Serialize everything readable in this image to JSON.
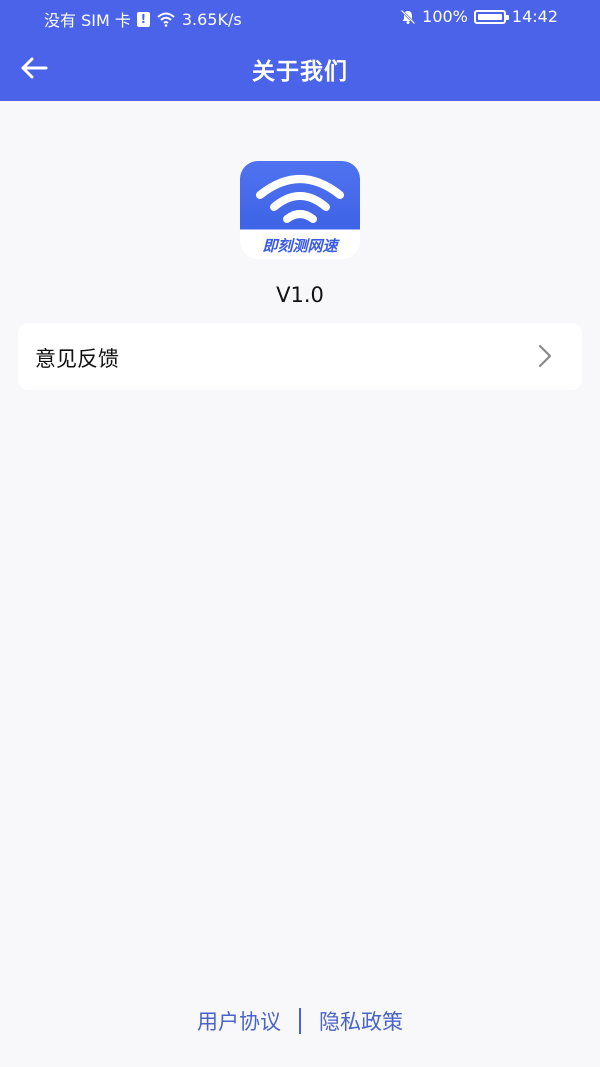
{
  "status_bar": {
    "carrier": "没有 SIM 卡",
    "network_speed": "3.65K/s",
    "battery_percent": "100%",
    "time": "14:42"
  },
  "header": {
    "title": "关于我们"
  },
  "app": {
    "logo_text": "即刻测网速",
    "version": "V1.0"
  },
  "menu": {
    "feedback_label": "意见反馈"
  },
  "footer": {
    "user_agreement": "用户协议",
    "privacy_policy": "隐私政策"
  },
  "colors": {
    "header_bg": "#4a63e8",
    "logo_blue": "#3f63e6",
    "footer_link": "#4a63c8"
  }
}
